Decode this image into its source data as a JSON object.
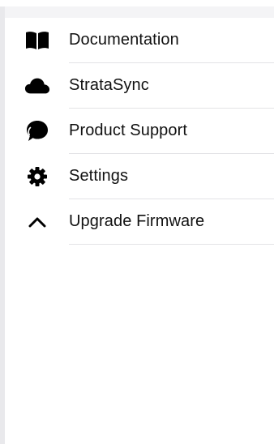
{
  "menu": {
    "items": [
      {
        "label": "Documentation",
        "icon": "book-icon"
      },
      {
        "label": "StrataSync",
        "icon": "cloud-icon"
      },
      {
        "label": "Product Support",
        "icon": "chat-bubble-icon"
      },
      {
        "label": "Settings",
        "icon": "gear-icon"
      },
      {
        "label": "Upgrade Firmware",
        "icon": "chevron-up-icon"
      }
    ]
  },
  "colors": {
    "text": "#111111",
    "icon": "#000000",
    "divider": "#e3e3e6",
    "edge": "#e9e9ec"
  }
}
